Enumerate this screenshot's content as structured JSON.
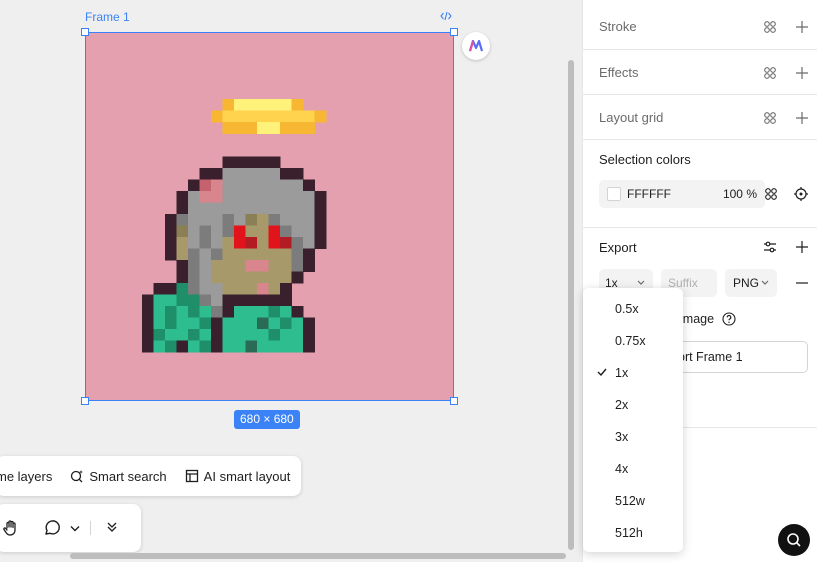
{
  "canvas": {
    "frame_label": "Frame 1",
    "size_badge": "680 × 680",
    "toolbar": {
      "items": [
        {
          "label": "me layers",
          "icon": "rename-layers-icon"
        },
        {
          "label": "Smart search",
          "icon": "smart-search-icon"
        },
        {
          "label": "AI smart layout",
          "icon": "layout-icon"
        }
      ],
      "bottom_tools": [
        "hand-tool-icon",
        "comment-icon",
        "chevron-down-icon",
        "collapse-icon"
      ]
    }
  },
  "panel": {
    "stroke": {
      "title": "Stroke"
    },
    "effects": {
      "title": "Effects"
    },
    "layout_grid": {
      "title": "Layout grid"
    },
    "selection_colors": {
      "title": "Selection colors",
      "hex": "FFFFFF",
      "opacity": "100",
      "opacity_unit": "%"
    },
    "export": {
      "title": "Export",
      "scale": "1x",
      "suffix_placeholder": "Suffix",
      "format": "PNG",
      "image_label": "image",
      "button_label": "ort Frame 1"
    }
  },
  "dropdown": {
    "options": [
      "0.5x",
      "0.75x",
      "1x",
      "2x",
      "3x",
      "4x",
      "512w",
      "512h"
    ],
    "selected": "1x"
  },
  "colors": {
    "accent": "#3b82f6",
    "frame_bg": "#e4a0af"
  }
}
